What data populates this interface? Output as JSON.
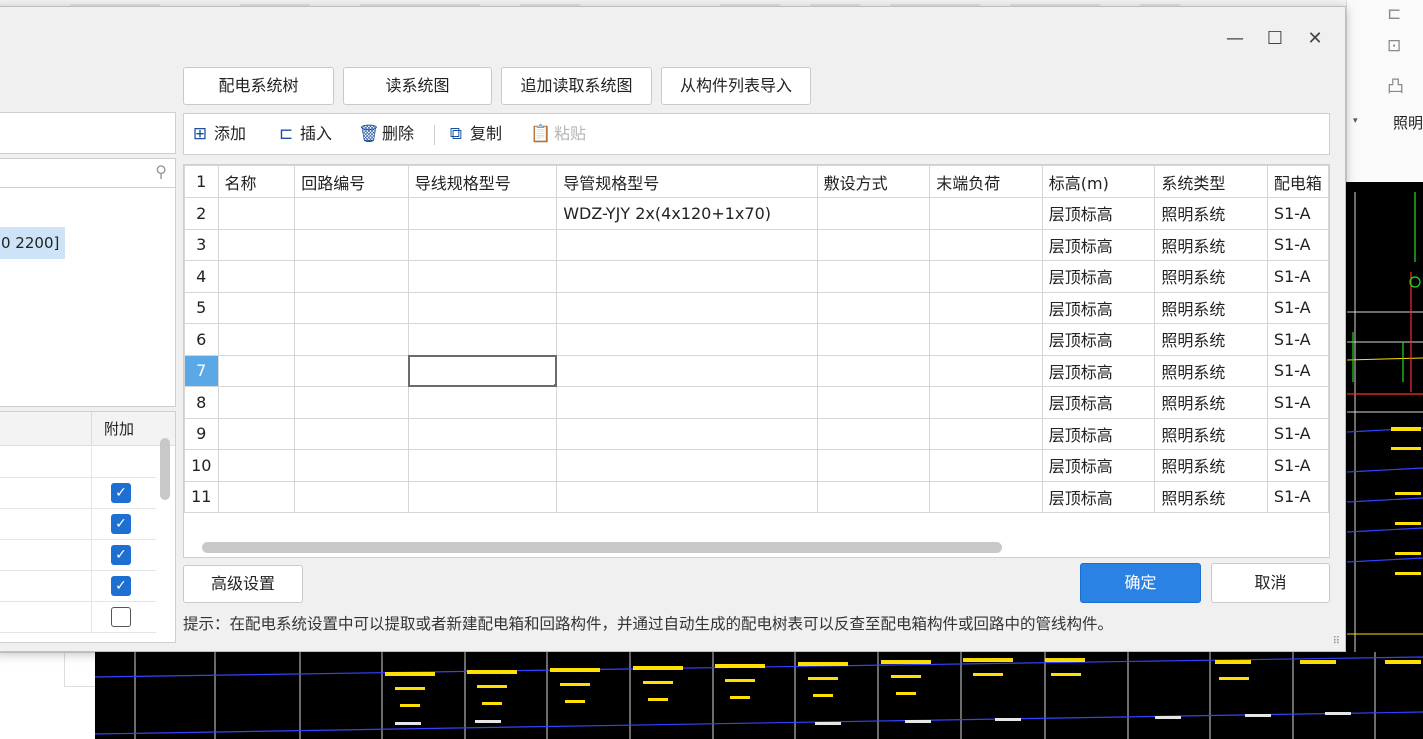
{
  "dialog": {
    "window_controls": {
      "minimize": "—",
      "maximize": "☐",
      "close": "✕"
    },
    "top_buttons": {
      "distribution_tree": "配电系统树",
      "read_system_diagram": "读系统图",
      "append_read_system_diagram": "追加读取系统图",
      "import_from_component_list": "从构件列表导入"
    },
    "toolbar": {
      "add": "添加",
      "insert": "插入",
      "delete": "删除",
      "copy": "复制",
      "paste": "粘贴"
    },
    "left_panel": {
      "tree_selected": "0 2200]",
      "prop_header": "附加",
      "checkboxes": [
        true,
        true,
        true,
        true,
        false
      ]
    },
    "grid": {
      "headers": [
        "名称",
        "回路编号",
        "导线规格型号",
        "导管规格型号",
        "敷设方式",
        "末端负荷",
        "标高(m)",
        "系统类型",
        "配电箱"
      ],
      "rows": [
        {
          "n": "2",
          "c": [
            "",
            "",
            "",
            "WDZ-YJY 2x(4x120+1x70)",
            "",
            "",
            "层顶标高",
            "照明系统",
            "S1-A"
          ]
        },
        {
          "n": "3",
          "c": [
            "",
            "",
            "",
            "",
            "",
            "",
            "层顶标高",
            "照明系统",
            "S1-A"
          ]
        },
        {
          "n": "4",
          "c": [
            "",
            "",
            "",
            "",
            "",
            "",
            "层顶标高",
            "照明系统",
            "S1-A"
          ]
        },
        {
          "n": "5",
          "c": [
            "",
            "",
            "",
            "",
            "",
            "",
            "层顶标高",
            "照明系统",
            "S1-A"
          ]
        },
        {
          "n": "6",
          "c": [
            "",
            "",
            "",
            "",
            "",
            "",
            "层顶标高",
            "照明系统",
            "S1-A"
          ]
        },
        {
          "n": "7",
          "c": [
            "",
            "",
            "",
            "",
            "",
            "",
            "层顶标高",
            "照明系统",
            "S1-A"
          ]
        },
        {
          "n": "8",
          "c": [
            "",
            "",
            "",
            "",
            "",
            "",
            "层顶标高",
            "照明系统",
            "S1-A"
          ]
        },
        {
          "n": "9",
          "c": [
            "",
            "",
            "",
            "",
            "",
            "",
            "层顶标高",
            "照明系统",
            "S1-A"
          ]
        },
        {
          "n": "10",
          "c": [
            "",
            "",
            "",
            "",
            "",
            "",
            "层顶标高",
            "照明系统",
            "S1-A"
          ]
        },
        {
          "n": "11",
          "c": [
            "",
            "",
            "",
            "",
            "",
            "",
            "层顶标高",
            "照明系统",
            "S1-A"
          ]
        }
      ],
      "active_row": "7"
    },
    "buttons": {
      "advanced": "高级设置",
      "ok": "确定",
      "cancel": "取消"
    },
    "tip": "提示：在配电系统设置中可以提取或者新建配电箱和回路构件，并通过自动生成的配电树表可以反查至配电箱构件或回路中的管线构件。"
  },
  "background_app": {
    "right_label": "照明"
  },
  "colors": {
    "accent": "#2a82e4",
    "active_row": "#5aa9e6",
    "checkbox": "#1e6fd2",
    "cad_background": "#000000"
  }
}
